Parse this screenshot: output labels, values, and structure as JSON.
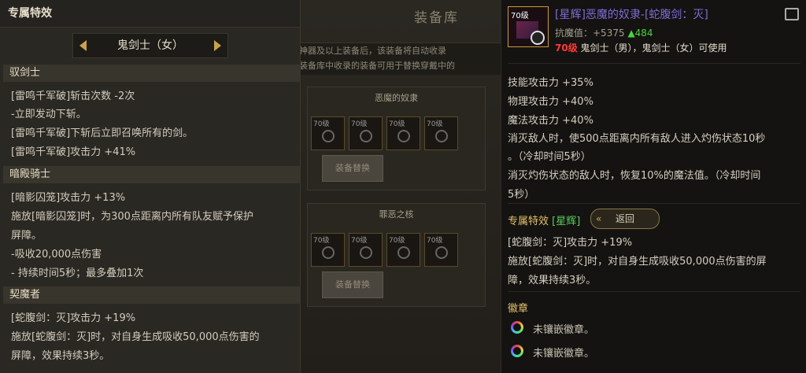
{
  "background": {
    "title": "装备库",
    "notice": [
      "神器及以上装备后，该装备将自动收录",
      "装备库中收录的装备可用于替换穿戴中的"
    ],
    "sets": [
      {
        "name": "恶魔的奴隶",
        "button": "装备替换",
        "slot_level": "70级"
      },
      {
        "name": "罪恶之核",
        "button": "装备替换",
        "slot_level": "70级"
      }
    ]
  },
  "left_panel": {
    "title": "专属特效",
    "selector": "鬼剑士（女）",
    "sections": [
      {
        "name": "驭剑士",
        "lines": [
          "[雷鸣千军破]斩击次数 -2次",
          "-立即发动下斩。",
          "[雷鸣千军破]下斩后立即召唤所有的剑。",
          "[雷鸣千军破]攻击力 +41%"
        ]
      },
      {
        "name": "暗殿骑士",
        "lines": [
          "[暗影囚笼]攻击力 +13%",
          "施放[暗影囚笼]时，为300点距离内所有队友赋予保护",
          "屏障。",
          "-吸收20,000点伤害",
          "- 持续时间5秒；最多叠加1次"
        ]
      },
      {
        "name": "契魔者",
        "lines": [
          "[蛇腹剑：灭]攻击力 +19%",
          "施放[蛇腹剑：灭]时，对自身生成吸收50,000点伤害的",
          "屏障，效果持续3秒。"
        ]
      }
    ]
  },
  "item": {
    "level_badge": "70级",
    "name": "[星辉]恶魔的奴隶-[蛇腹剑：灭]",
    "atk_label": "抗魔值：+5375",
    "atk_up": "▲484",
    "req_level": "70级",
    "req_text": "鬼剑士（男），鬼剑士（女）可使用",
    "stats": [
      "技能攻击力 +35%",
      "物理攻击力 +40%",
      "魔法攻击力 +40%",
      "消灭敌人时，使500点距离内所有敌人进入灼伤状态10秒",
      "。（冷却时间5秒）",
      "消灭灼伤状态的敌人时，恢复10%的魔法值。（冷却时间",
      "5秒）"
    ],
    "exclusive_label": "专属特效",
    "exclusive_tag": "[星辉]",
    "back_button": "返回",
    "exclusive_lines": [
      "[蛇腹剑：灭]攻击力 +19%",
      "施放[蛇腹剑：灭]时，对自身生成吸收50,000点伤害的屏",
      "障，效果持续3秒。"
    ],
    "emblem_head": "徽章",
    "emblems": [
      "未镶嵌徽章。",
      "未镶嵌徽章。"
    ]
  }
}
